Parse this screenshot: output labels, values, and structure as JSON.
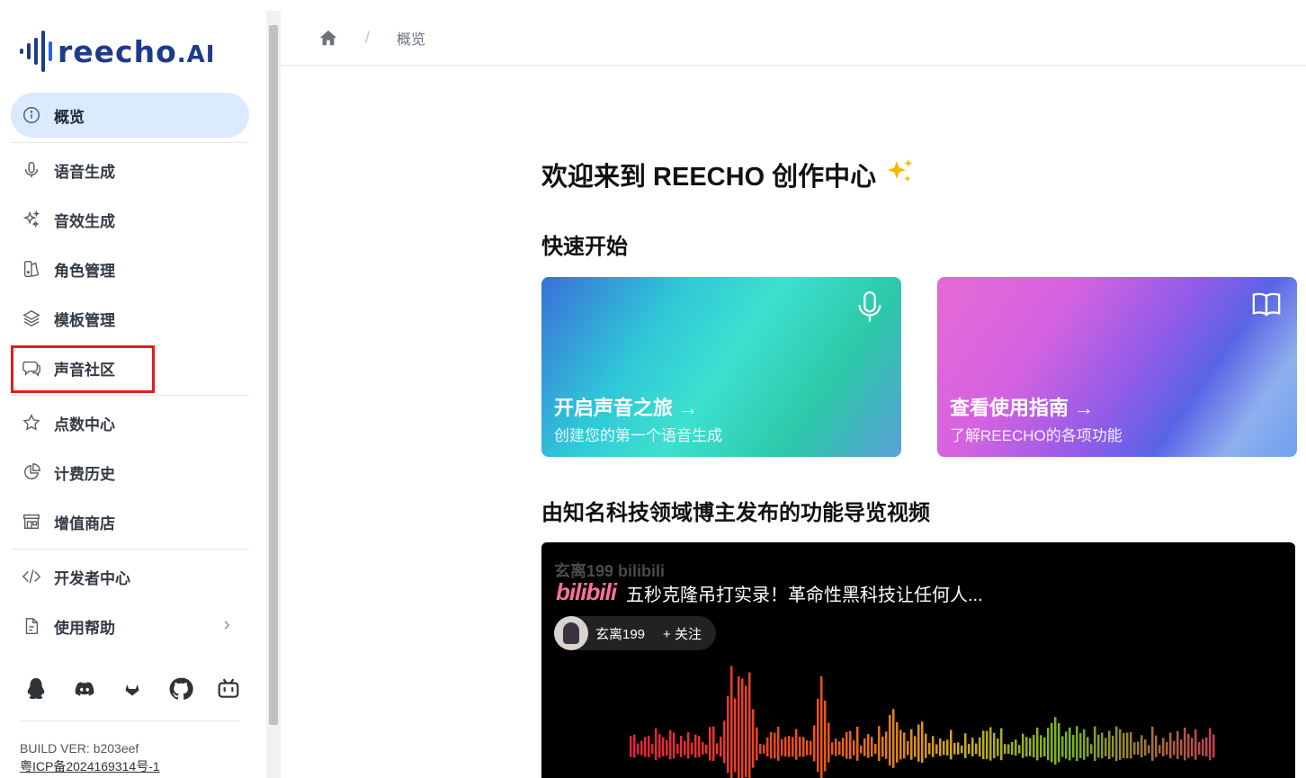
{
  "brand": {
    "logo_text": "reecho",
    "logo_suffix": ".AI"
  },
  "sidebar": {
    "items": [
      {
        "id": "overview",
        "label": "概览",
        "icon": "info-icon",
        "active": true
      },
      {
        "id": "speech",
        "label": "语音生成",
        "icon": "microphone-icon"
      },
      {
        "id": "sfx",
        "label": "音效生成",
        "icon": "sparkles-icon"
      },
      {
        "id": "roles",
        "label": "角色管理",
        "icon": "character-icon"
      },
      {
        "id": "templates",
        "label": "模板管理",
        "icon": "layers-icon"
      },
      {
        "id": "community",
        "label": "声音社区",
        "icon": "chat-icon"
      },
      {
        "id": "points",
        "label": "点数中心",
        "icon": "star-icon"
      },
      {
        "id": "billing",
        "label": "计费历史",
        "icon": "pie-chart-icon"
      },
      {
        "id": "store",
        "label": "增值商店",
        "icon": "store-icon"
      },
      {
        "id": "developer",
        "label": "开发者中心",
        "icon": "code-icon"
      },
      {
        "id": "help",
        "label": "使用帮助",
        "icon": "document-icon"
      }
    ],
    "social": [
      "qq-icon",
      "discord-icon",
      "gitlab-icon",
      "github-icon",
      "bilibili-icon"
    ],
    "build_ver": "BUILD VER: b203eef",
    "icp": "粤ICP备2024169314号-1"
  },
  "breadcrumb": {
    "current": "概览"
  },
  "main": {
    "welcome": "欢迎来到 REECHO 创作中心",
    "quick_start": "快速开始",
    "cards": [
      {
        "title": "开启声音之旅 →",
        "subtitle": "创建您的第一个语音生成",
        "icon": "microphone-icon"
      },
      {
        "title": "查看使用指南 →",
        "subtitle": "了解REECHO的各项功能",
        "icon": "book-icon"
      }
    ],
    "videos_title": "由知名科技领域博主发布的功能导览视频",
    "video": {
      "watermark": "玄离199 bilibili",
      "platform": "bilibili",
      "title": "五秒克隆吊打实录！革命性黑科技让任何人...",
      "author": "玄离199",
      "follow": "+ 关注"
    }
  },
  "colors": {
    "accent": "#2563eb",
    "active_bg": "#dbeafe",
    "highlight": "#e11d1d",
    "bili_pink": "#fb7299"
  }
}
